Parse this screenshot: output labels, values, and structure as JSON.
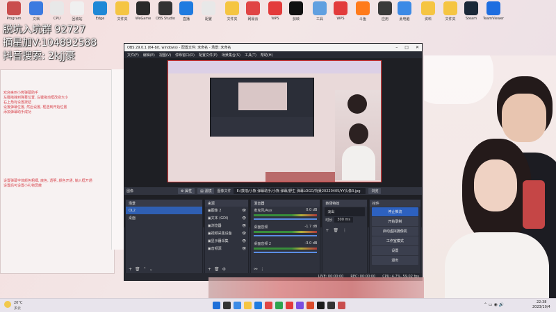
{
  "overlay": {
    "line1": "脱坑入坑群 92727",
    "line2": "摘星加V:104892588",
    "line3": "抖音搜索: 2kjj豪"
  },
  "desktop_icons": [
    {
      "label": "Program",
      "color": "#c94d4d"
    },
    {
      "label": "文档",
      "color": "#3c7ae0"
    },
    {
      "label": "CPU",
      "color": "#e8e8e8"
    },
    {
      "label": "回收站",
      "color": "#f0f0f0"
    },
    {
      "label": "Edge",
      "color": "#1e88d6"
    },
    {
      "label": "文件夹",
      "color": "#f5c542"
    },
    {
      "label": "WeGame",
      "color": "#2a2a2a"
    },
    {
      "label": "OBS Studio",
      "color": "#333"
    },
    {
      "label": "直播",
      "color": "#1f7be0"
    },
    {
      "label": "配置",
      "color": "#e8e8e8"
    },
    {
      "label": "文件夹",
      "color": "#f5c542"
    },
    {
      "label": "网易云",
      "color": "#e04545"
    },
    {
      "label": "WPS",
      "color": "#e33b3b"
    },
    {
      "label": "剪映",
      "color": "#111"
    },
    {
      "label": "工具",
      "color": "#60a0e0"
    },
    {
      "label": "WPS",
      "color": "#e23b3b"
    },
    {
      "label": "斗鱼",
      "color": "#ff7a1a"
    },
    {
      "label": "应用",
      "color": "#3a3a3a"
    },
    {
      "label": "此电脑",
      "color": "#3b8ae6"
    },
    {
      "label": "资料",
      "color": "#f5c542"
    },
    {
      "label": "文件夹",
      "color": "#f5c542"
    },
    {
      "label": "Steam",
      "color": "#1b2838"
    },
    {
      "label": "TeamViewer",
      "color": "#1e6de0"
    }
  ],
  "notepad": {
    "lines": [
      "欢迎来到小熊弹幕助手",
      "左键拖拽到弹幕位置, 左键拖动框改变大小",
      "右上角有设置按钮",
      "设置弹幕位置, 然后设置, 框选到开始位置",
      "添加弹幕助手成功"
    ],
    "lines2": [
      "设置弹幕字体颜色粗细, 底色, 透明, 颜色开通, 输入框开通",
      "设置后可设置小礼物屏蔽"
    ]
  },
  "obs": {
    "title": "OBS 29.0.1 (64-bit, windows) - 配置文件: 未命名 - 场景: 未命名",
    "menu": [
      "文件(F)",
      "编辑(E)",
      "视图(V)",
      "停靠窗口(D)",
      "配置文件(P)",
      "场景集合(S)",
      "工具(T)",
      "帮助(H)"
    ],
    "source_bar": {
      "label": "图像",
      "props": "属性",
      "filters": "滤镜",
      "image_file": "图像文件",
      "path": "E:/鼓墙/小熊 弹幕助手/小熊 弹幕/野生 弹幕LOGO/背景20220405/YY头像3.jpg",
      "browse": "浏览"
    },
    "docks": {
      "scenes": {
        "title": "场景",
        "items": [
          "OL2",
          "桌面"
        ]
      },
      "sources": {
        "title": "来源",
        "items": [
          "图像 2",
          "文本 (GDI)",
          "浏览器",
          "视频采集设备",
          "显示器采集",
          "音频源"
        ]
      },
      "mixer": {
        "title": "混音器",
        "channels": [
          {
            "name": "麦克风/Aux",
            "db": "0.0 dB"
          },
          {
            "name": "桌面音频",
            "db": "-1.7 dB"
          },
          {
            "name": "桌面音频 2",
            "db": "-3.0 dB"
          }
        ]
      },
      "transitions": {
        "title": "转场特效",
        "type": "淡出",
        "duration_label": "时长",
        "duration": "300 ms"
      },
      "controls": {
        "title": "控件",
        "buttons": [
          "停止推流",
          "开始录制",
          "启动虚拟摄像机",
          "工作室模式",
          "设置",
          "退出"
        ]
      }
    },
    "status": {
      "live": "LIVE: 00:00:00",
      "rec": "REC: 00:00:00",
      "cpu": "CPU: 4.7%, 59.02 fps"
    }
  },
  "taskbar": {
    "weather_temp": "20°C",
    "weather_desc": "多云",
    "time": "22:38",
    "date": "2023/10/4"
  }
}
